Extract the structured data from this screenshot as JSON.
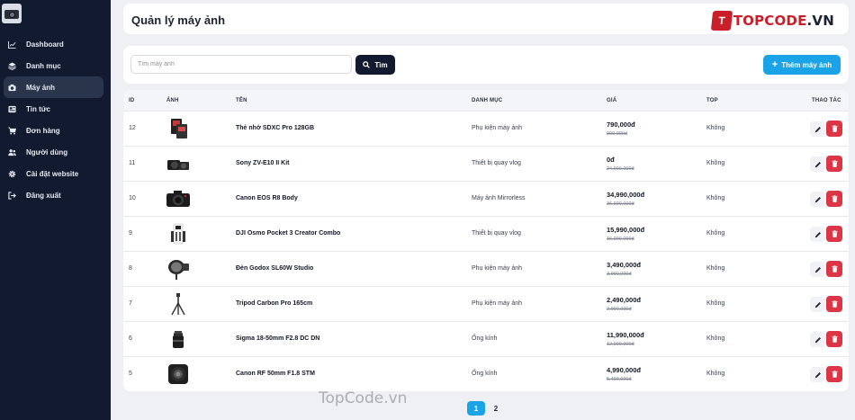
{
  "sidebar": {
    "items": [
      {
        "label": "Dashboard",
        "icon": "chart-line-icon",
        "active": false
      },
      {
        "label": "Danh mục",
        "icon": "layers-icon",
        "active": false
      },
      {
        "label": "Máy ảnh",
        "icon": "camera-icon",
        "active": true
      },
      {
        "label": "Tin tức",
        "icon": "newspaper-icon",
        "active": false
      },
      {
        "label": "Đơn hàng",
        "icon": "cart-icon",
        "active": false
      },
      {
        "label": "Người dùng",
        "icon": "users-icon",
        "active": false
      },
      {
        "label": "Cài đặt website",
        "icon": "gear-icon",
        "active": false
      },
      {
        "label": "Đăng xuất",
        "icon": "logout-icon",
        "active": false
      }
    ]
  },
  "header": {
    "title": "Quản lý máy ảnh",
    "brand_mark": "T",
    "brand_name": "TOPCODE",
    "brand_suffix": ".VN"
  },
  "toolbar": {
    "search_placeholder": "Tìm máy ảnh",
    "search_value": "",
    "search_label": "Tìm",
    "add_label": "Thêm máy ảnh"
  },
  "table": {
    "columns": [
      "ID",
      "Ảnh",
      "Tên",
      "Danh mục",
      "Giá",
      "Top",
      "Thao tác"
    ],
    "rows": [
      {
        "id": "12",
        "name": "Thẻ nhớ SDXC Pro 128GB",
        "category": "Phụ kiện máy ảnh",
        "price": "790,000đ",
        "old_price": "990,000đ",
        "top": "Không",
        "thumb": "memory-card"
      },
      {
        "id": "11",
        "name": "Sony ZV-E10 II Kit",
        "category": "Thiết bị quay vlog",
        "price": "0đ",
        "old_price": "24,990,000đ",
        "top": "Không",
        "thumb": "mirrorless-kit"
      },
      {
        "id": "10",
        "name": "Canon EOS R8 Body",
        "category": "Máy ảnh Mirrorless",
        "price": "34,990,000đ",
        "old_price": "36,990,000đ",
        "top": "Không",
        "thumb": "camera-body"
      },
      {
        "id": "9",
        "name": "DJI Osmo Pocket 3 Creator Combo",
        "category": "Thiết bị quay vlog",
        "price": "15,990,000đ",
        "old_price": "16,990,000đ",
        "top": "Không",
        "thumb": "combo-kit"
      },
      {
        "id": "8",
        "name": "Đèn Godox SL60W Studio",
        "category": "Phụ kiện máy ảnh",
        "price": "3,490,000đ",
        "old_price": "3,990,000đ",
        "top": "Không",
        "thumb": "studio-light"
      },
      {
        "id": "7",
        "name": "Tripod Carbon Pro 165cm",
        "category": "Phụ kiện máy ảnh",
        "price": "2,490,000đ",
        "old_price": "2,990,000đ",
        "top": "Không",
        "thumb": "tripod"
      },
      {
        "id": "6",
        "name": "Sigma 18-50mm F2.8 DC DN",
        "category": "Ống kính",
        "price": "11,990,000đ",
        "old_price": "12,990,000đ",
        "top": "Không",
        "thumb": "lens-small"
      },
      {
        "id": "5",
        "name": "Canon RF 50mm F1.8 STM",
        "category": "Ống kính",
        "price": "4,990,000đ",
        "old_price": "5,490,000đ",
        "top": "Không",
        "thumb": "lens-large"
      }
    ]
  },
  "pagination": {
    "pages": [
      "1",
      "2"
    ],
    "current": "1"
  },
  "watermark": "TopCode.vn",
  "colors": {
    "sidebar": "#111a2e",
    "accent": "#1aa3e6",
    "danger": "#dc3545",
    "brand": "#c91f2b"
  }
}
